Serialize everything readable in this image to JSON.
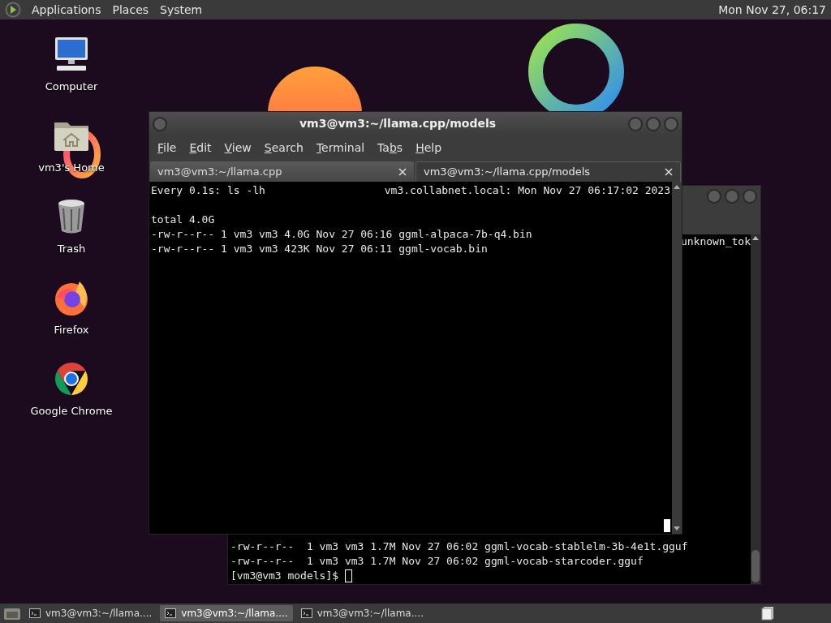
{
  "top_panel": {
    "menus": [
      "Applications",
      "Places",
      "System"
    ],
    "clock": "Mon Nov 27, 06:17"
  },
  "desktop_icons": [
    {
      "label": "Computer",
      "kind": "computer"
    },
    {
      "label": "vm3's Home",
      "kind": "home"
    },
    {
      "label": "Trash",
      "kind": "trash"
    },
    {
      "label": "Firefox",
      "kind": "firefox"
    },
    {
      "label": "Google Chrome",
      "kind": "chrome"
    }
  ],
  "back_terminal": {
    "top_text": "unknown_tok",
    "lines": [
      "-rw-r--r--  1 vm3 vm3 1.7M Nov 27 06:02 ggml-vocab-stablelm-3b-4e1t.gguf",
      "-rw-r--r--  1 vm3 vm3 1.7M Nov 27 06:02 ggml-vocab-starcoder.gguf"
    ],
    "prompt": "[vm3@vm3 models]$"
  },
  "front_terminal": {
    "title": "vm3@vm3:~/llama.cpp/models",
    "menu": [
      {
        "key": "F",
        "after": "ile"
      },
      {
        "key": "E",
        "after": "dit"
      },
      {
        "key": "V",
        "after": "iew"
      },
      {
        "key": "S",
        "after": "earch"
      },
      {
        "key": "T",
        "after": "erminal"
      },
      {
        "before": "Ta",
        "key": "b",
        "after": "s"
      },
      {
        "key": "H",
        "after": "elp"
      }
    ],
    "tabs": [
      {
        "label": "vm3@vm3:~/llama.cpp",
        "selected": false
      },
      {
        "label": "vm3@vm3:~/llama.cpp/models",
        "selected": true
      }
    ],
    "header_left": "Every 0.1s: ls -lh",
    "header_right": "vm3.collabnet.local: Mon Nov 27 06:17:02 2023",
    "lines": [
      "total 4.0G",
      "-rw-r--r-- 1 vm3 vm3 4.0G Nov 27 06:16 ggml-alpaca-7b-q4.bin",
      "-rw-r--r-- 1 vm3 vm3 423K Nov 27 06:11 ggml-vocab.bin"
    ]
  },
  "taskbar": {
    "items": [
      {
        "label": "vm3@vm3:~/llama....",
        "selected": false
      },
      {
        "label": "vm3@vm3:~/llama....",
        "selected": true
      },
      {
        "label": "vm3@vm3:~/llama....",
        "selected": false
      }
    ]
  }
}
